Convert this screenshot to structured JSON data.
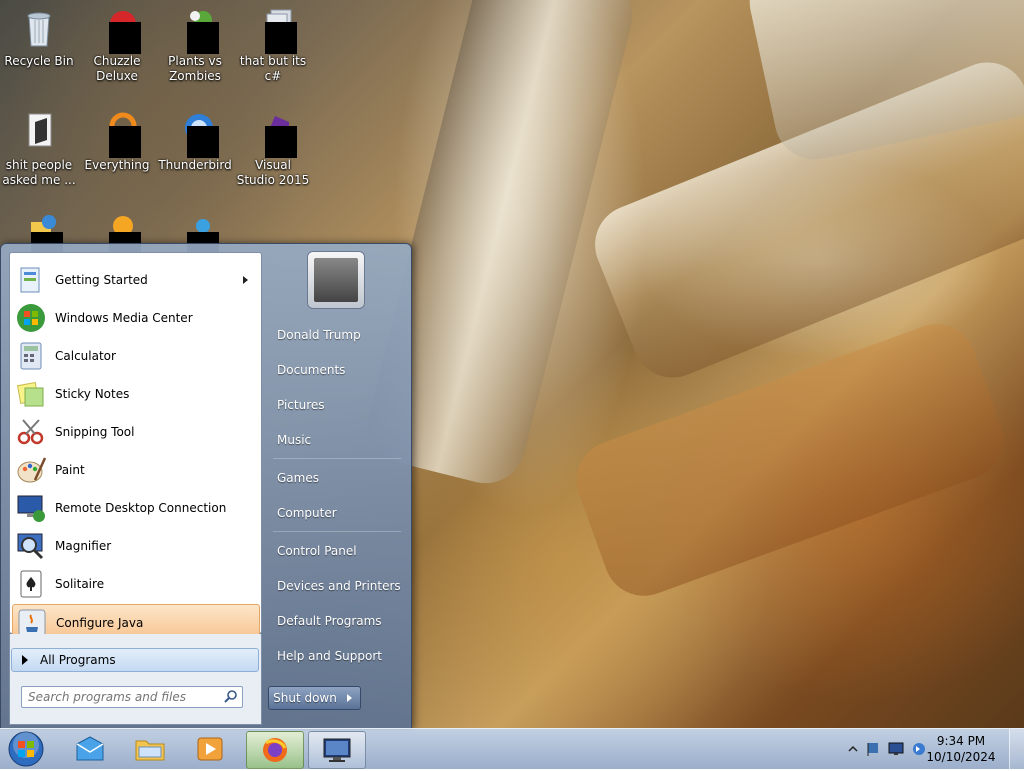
{
  "desktop": {
    "icons": [
      {
        "label": "Recycle Bin"
      },
      {
        "label": "Chuzzle Deluxe"
      },
      {
        "label": "Plants vs Zombies"
      },
      {
        "label": "that but its c#"
      },
      {
        "label": "shit people asked me ..."
      },
      {
        "label": "Everything"
      },
      {
        "label": "Thunderbird"
      },
      {
        "label": "Visual Studio 2015"
      }
    ]
  },
  "start_menu": {
    "programs": [
      {
        "label": "Getting Started",
        "icon": "getting-started-icon",
        "submenu": true
      },
      {
        "label": "Windows Media Center",
        "icon": "windows-media-center-icon"
      },
      {
        "label": "Calculator",
        "icon": "calculator-icon"
      },
      {
        "label": "Sticky Notes",
        "icon": "sticky-notes-icon"
      },
      {
        "label": "Snipping Tool",
        "icon": "snipping-tool-icon"
      },
      {
        "label": "Paint",
        "icon": "paint-icon"
      },
      {
        "label": "Remote Desktop Connection",
        "icon": "remote-desktop-icon"
      },
      {
        "label": "Magnifier",
        "icon": "magnifier-icon"
      },
      {
        "label": "Solitaire",
        "icon": "solitaire-icon"
      },
      {
        "label": "Configure Java",
        "icon": "java-icon",
        "highlighted": true
      }
    ],
    "all_programs": "All Programs",
    "search_placeholder": "Search programs and files",
    "right_links": [
      {
        "label": "Donald Trump"
      },
      {
        "label": "Documents"
      },
      {
        "label": "Pictures"
      },
      {
        "label": "Music"
      },
      {
        "label": "Games"
      },
      {
        "label": "Computer"
      },
      {
        "label": "Control Panel"
      },
      {
        "label": "Devices and Printers"
      },
      {
        "label": "Default Programs"
      },
      {
        "label": "Help and Support"
      }
    ],
    "shutdown": "Shut down"
  },
  "taskbar": {
    "pinned": [
      {
        "icon": "windows-live-mail-icon"
      },
      {
        "icon": "file-explorer-icon"
      },
      {
        "icon": "media-player-icon"
      },
      {
        "icon": "firefox-icon",
        "active": true
      },
      {
        "icon": "monitor-icon",
        "active": true
      }
    ],
    "clock": {
      "time": "9:34 PM",
      "date": "10/10/2024"
    }
  },
  "colors": {
    "taskbar": "#a8bcd8",
    "highlight": "#f7c28c",
    "start_right_pane": "#6f86a8"
  }
}
